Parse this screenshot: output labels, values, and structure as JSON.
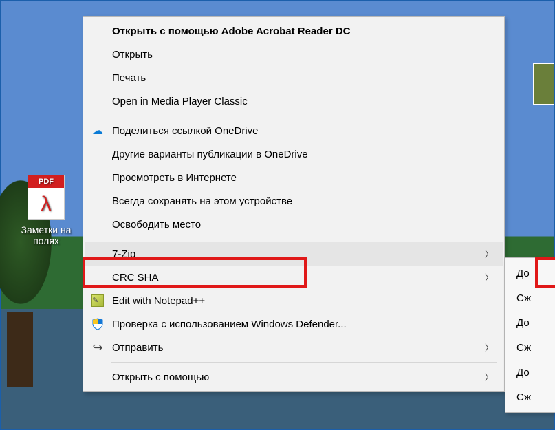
{
  "desktop": {
    "pdf_label_line1": "Заметки на",
    "pdf_label_line2": "полях",
    "pdf_badge_text": "PDF"
  },
  "menu": {
    "open_with_app": "Открыть с помощью Adobe Acrobat Reader DC",
    "open": "Открыть",
    "print": "Печать",
    "open_media": "Open in Media Player Classic",
    "share_onedrive": "Поделиться ссылкой OneDrive",
    "other_onedrive": "Другие варианты публикации в OneDrive",
    "view_internet": "Просмотреть в Интернете",
    "keep_device": "Всегда сохранять на этом устройстве",
    "free_space": "Освободить место",
    "sevenzip": "7-Zip",
    "crc_sha": "CRC SHA",
    "edit_notepad": "Edit with Notepad++",
    "defender": "Проверка с использованием Windows Defender...",
    "send": "Отправить",
    "open_with": "Открыть с помощью"
  },
  "submenu": {
    "i0": "До",
    "i1": "Сж",
    "i2": "До",
    "i3": "Сж",
    "i4": "До",
    "i5": "Сж"
  }
}
